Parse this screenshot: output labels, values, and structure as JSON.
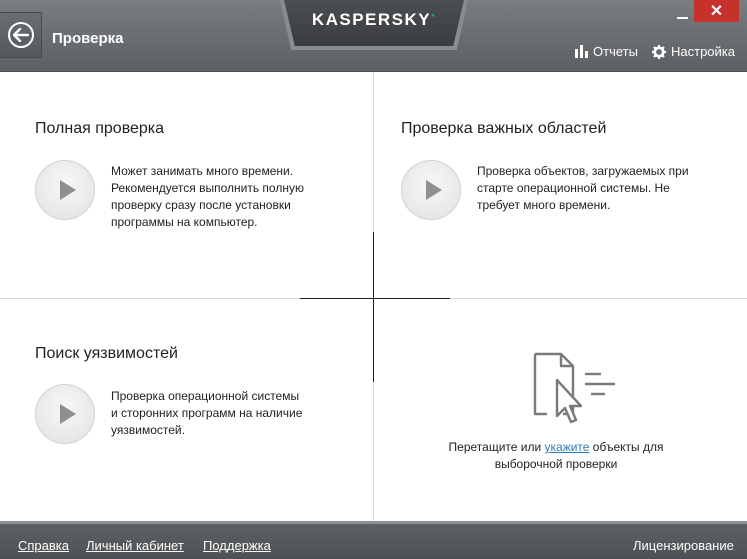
{
  "window": {
    "title": "Проверка",
    "logo": "KASPERSKY",
    "close_glyph": "✕"
  },
  "header": {
    "reports_label": "Отчеты",
    "settings_label": "Настройка"
  },
  "sections": {
    "full_scan": {
      "title": "Полная проверка",
      "description": "Может занимать много времени.\nРекомендуется выполнить полную\nпроверку сразу после установки\nпрограммы на компьютер."
    },
    "critical_scan": {
      "title": "Проверка важных областей",
      "description": "Проверка объектов, загружаемых при\nстарте операционной системы. Не\nтребует много времени."
    },
    "vuln_scan": {
      "title": "Поиск уязвимостей",
      "description": "Проверка операционной системы\n и сторонних программ на наличие\nуязвимостей."
    },
    "custom_scan": {
      "text_before": "Перетащите или ",
      "link": "укажите",
      "text_after": " объекты для",
      "line2": "выборочной проверки"
    }
  },
  "footer": {
    "help": "Справка",
    "account": "Личный кабинет",
    "support": "Поддержка",
    "licensing": "Лицензирование"
  },
  "colors": {
    "header_bg": "#6b6e71",
    "close_button": "#c7312c",
    "link": "#2b7bb9",
    "brand_accent": "#1fa36f"
  },
  "icons": {
    "back": "back-arrow-icon",
    "reports": "bar-chart-icon",
    "settings": "gear-icon",
    "play": "play-icon",
    "drop": "file-cursor-icon"
  }
}
